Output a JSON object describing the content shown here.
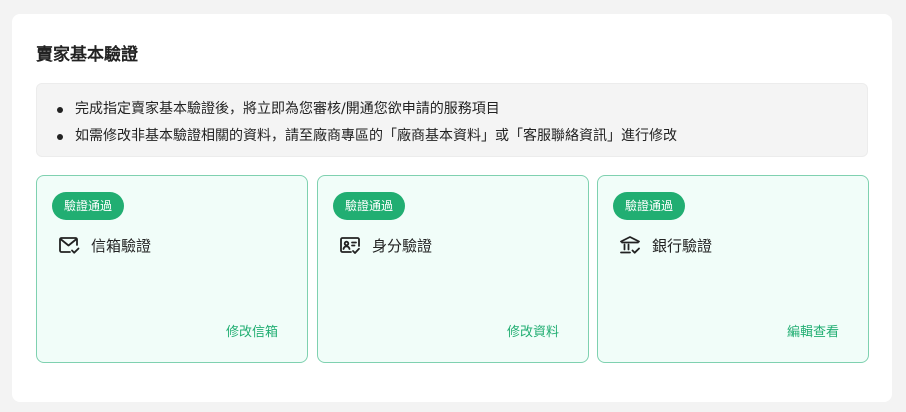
{
  "section": {
    "title": "賣家基本驗證"
  },
  "notice": {
    "items": [
      "完成指定賣家基本驗證後，將立即為您審核/開通您欲申請的服務項目",
      "如需修改非基本驗證相關的資料，請至廠商專區的「廠商基本資料」或「客服聯絡資訊」進行修改"
    ]
  },
  "cards": [
    {
      "badge": "驗證通過",
      "icon": "mail-check-icon",
      "title": "信箱驗證",
      "link": "修改信箱"
    },
    {
      "badge": "驗證通過",
      "icon": "id-card-check-icon",
      "title": "身分驗證",
      "link": "修改資料"
    },
    {
      "badge": "驗證通過",
      "icon": "bank-check-icon",
      "title": "銀行驗證",
      "link": "編輯查看"
    }
  ],
  "colors": {
    "accent": "#21ae72",
    "card_bg": "#f1fdf9",
    "card_border": "#7fd1b0"
  }
}
